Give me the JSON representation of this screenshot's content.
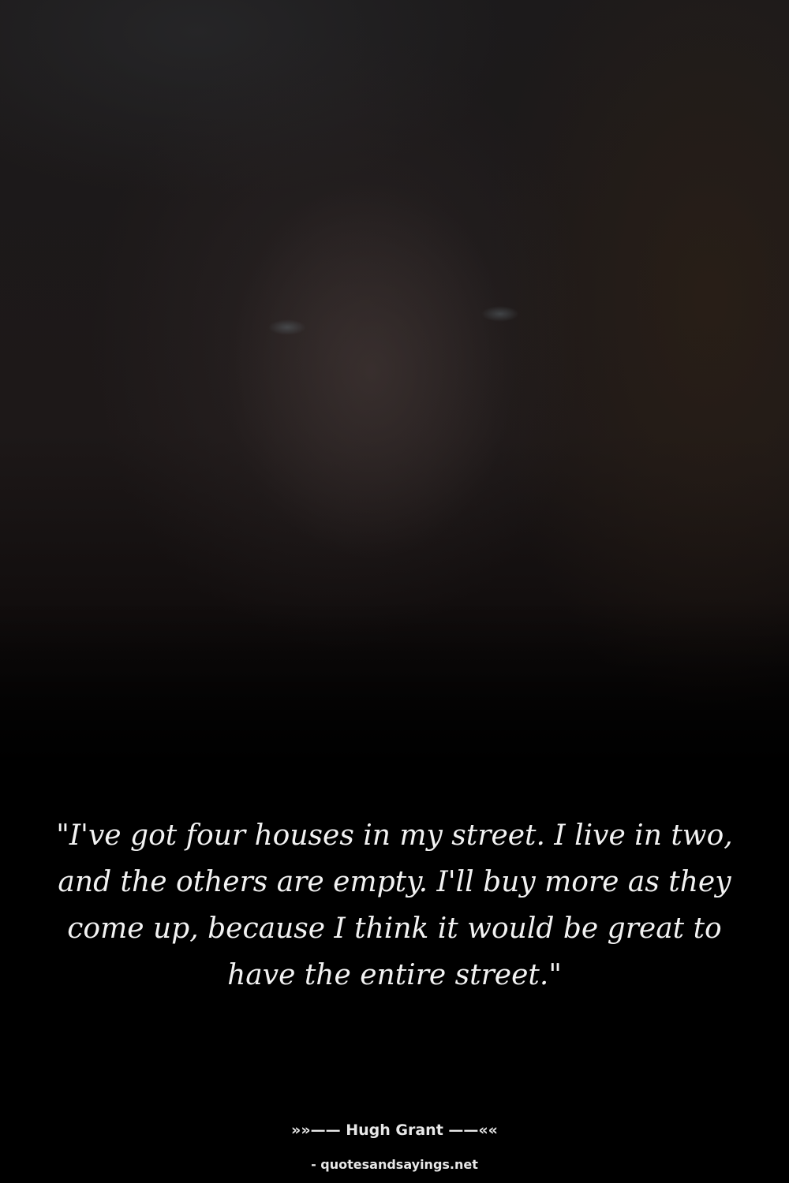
{
  "quote": {
    "text": "\"I've got four houses in my street. I live in two, and the others are empty. I'll buy more as they come up, because I think it would be great to have the entire street.\""
  },
  "attribution": {
    "author_line": "»»—— Hugh Grant ——««"
  },
  "source": {
    "site": "- quotesandsayings.net"
  },
  "colors": {
    "background": "#000000",
    "text": "#f2f2f2"
  }
}
